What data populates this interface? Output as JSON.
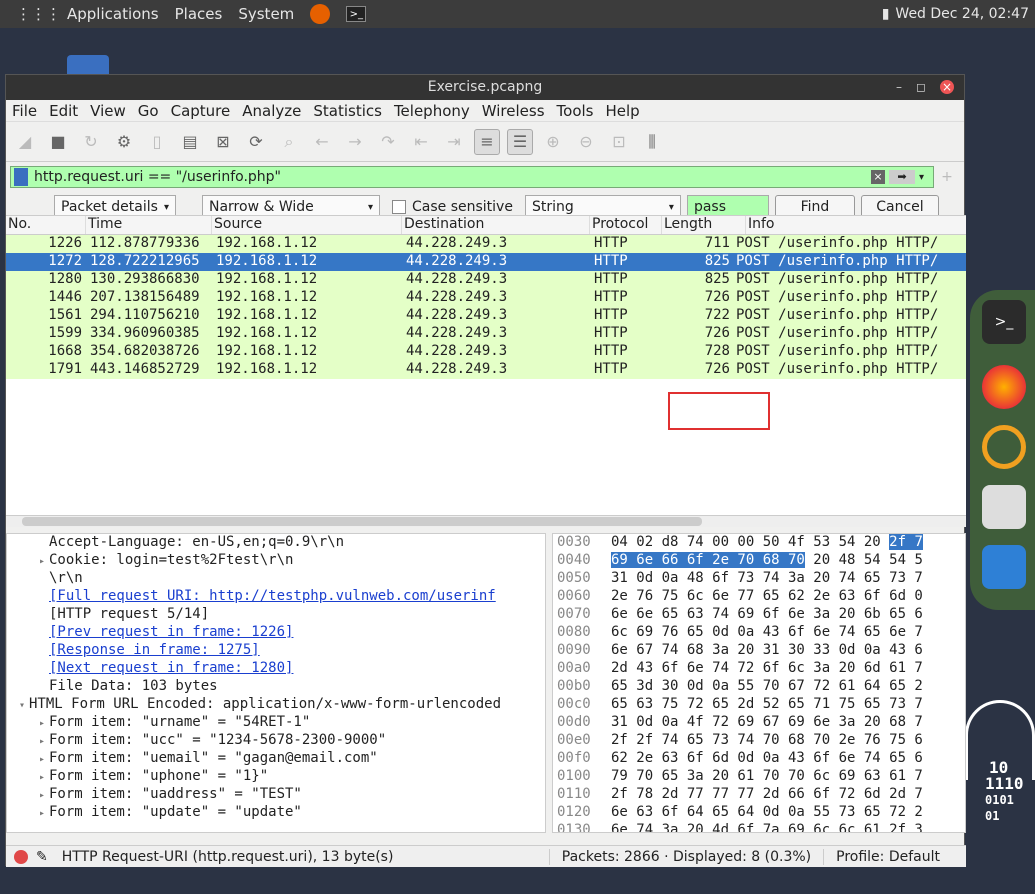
{
  "topbar": {
    "applications": "Applications",
    "places": "Places",
    "system": "System",
    "clock": "Wed Dec 24, 02:47"
  },
  "window": {
    "title": "Exercise.pcapng"
  },
  "menu": [
    "File",
    "Edit",
    "View",
    "Go",
    "Capture",
    "Analyze",
    "Statistics",
    "Telephony",
    "Wireless",
    "Tools",
    "Help"
  ],
  "filter": {
    "value": "http.request.uri == \"/userinfo.php\""
  },
  "find": {
    "search_in": "Packet details",
    "char_width": "Narrow & Wide",
    "case_sensitive": "Case sensitive",
    "type": "String",
    "query": "pass",
    "find_label": "Find",
    "cancel_label": "Cancel"
  },
  "columns": [
    "No.",
    "Time",
    "Source",
    "Destination",
    "Protocol",
    "Length",
    "Info"
  ],
  "packets": [
    {
      "no": "1226",
      "time": "112.878779336",
      "src": "192.168.1.12",
      "dst": "44.228.249.3",
      "proto": "HTTP",
      "len": "711",
      "info": "POST /userinfo.php HTTP/"
    },
    {
      "no": "1272",
      "time": "128.722212965",
      "src": "192.168.1.12",
      "dst": "44.228.249.3",
      "proto": "HTTP",
      "len": "825",
      "info": "POST /userinfo.php HTTP/"
    },
    {
      "no": "1280",
      "time": "130.293866830",
      "src": "192.168.1.12",
      "dst": "44.228.249.3",
      "proto": "HTTP",
      "len": "825",
      "info": "POST /userinfo.php HTTP/"
    },
    {
      "no": "1446",
      "time": "207.138156489",
      "src": "192.168.1.12",
      "dst": "44.228.249.3",
      "proto": "HTTP",
      "len": "726",
      "info": "POST /userinfo.php HTTP/"
    },
    {
      "no": "1561",
      "time": "294.110756210",
      "src": "192.168.1.12",
      "dst": "44.228.249.3",
      "proto": "HTTP",
      "len": "722",
      "info": "POST /userinfo.php HTTP/"
    },
    {
      "no": "1599",
      "time": "334.960960385",
      "src": "192.168.1.12",
      "dst": "44.228.249.3",
      "proto": "HTTP",
      "len": "726",
      "info": "POST /userinfo.php HTTP/"
    },
    {
      "no": "1668",
      "time": "354.682038726",
      "src": "192.168.1.12",
      "dst": "44.228.249.3",
      "proto": "HTTP",
      "len": "728",
      "info": "POST /userinfo.php HTTP/"
    },
    {
      "no": "1791",
      "time": "443.146852729",
      "src": "192.168.1.12",
      "dst": "44.228.249.3",
      "proto": "HTTP",
      "len": "726",
      "info": "POST /userinfo.php HTTP/"
    }
  ],
  "details": [
    "Accept-Language: en-US,en;q=0.9\\r\\n",
    "Cookie: login=test%2Ftest\\r\\n",
    "\\r\\n",
    "[Full request URI: http://testphp.vulnweb.com/userinf",
    "[HTTP request 5/14]",
    "[Prev request in frame: 1226]",
    "[Response in frame: 1275]",
    "[Next request in frame: 1280]",
    "File Data: 103 bytes",
    "HTML Form URL Encoded: application/x-www-form-urlencoded",
    "Form item: \"urname\" = \"54RET-1\"",
    "Form item: \"ucc\" = \"1234-5678-2300-9000\"",
    "Form item: \"uemail\" = \"gagan@email.com\"",
    "Form item: \"uphone\" = \"1}\"",
    "Form item: \"uaddress\" = \"TEST\"",
    "Form item: \"update\" = \"update\""
  ],
  "bytes": [
    {
      "off": "0030",
      "hex": "04 02 d8 74 00 00 50 4f  53 54 20 2f 7"
    },
    {
      "off": "0040",
      "hex": "69 6e 66 6f 2e 70 68 70  20 48 54 54 5"
    },
    {
      "off": "0050",
      "hex": "31 0d 0a 48 6f 73 74 3a  20 74 65 73 7"
    },
    {
      "off": "0060",
      "hex": "2e 76 75 6c 6e 77 65 62  2e 63 6f 6d 0"
    },
    {
      "off": "0070",
      "hex": "6e 6e 65 63 74 69 6f 6e  3a 20 6b 65 6"
    },
    {
      "off": "0080",
      "hex": "6c 69 76 65 0d 0a 43 6f  6e 74 65 6e 7"
    },
    {
      "off": "0090",
      "hex": "6e 67 74 68 3a 20 31 30  33 0d 0a 43 6"
    },
    {
      "off": "00a0",
      "hex": "2d 43 6f 6e 74 72 6f 6c  3a 20 6d 61 7"
    },
    {
      "off": "00b0",
      "hex": "65 3d 30 0d 0a 55 70 67  72 61 64 65 2"
    },
    {
      "off": "00c0",
      "hex": "65 63 75 72 65 2d 52 65  71 75 65 73 7"
    },
    {
      "off": "00d0",
      "hex": "31 0d 0a 4f 72 69 67 69  6e 3a 20 68 7"
    },
    {
      "off": "00e0",
      "hex": "2f 2f 74 65 73 74 70 68  70 2e 76 75 6"
    },
    {
      "off": "00f0",
      "hex": "62 2e 63 6f 6d 0d 0a 43  6f 6e 74 65 6"
    },
    {
      "off": "0100",
      "hex": "79 70 65 3a 20 61 70 70  6c 69 63 61 7"
    },
    {
      "off": "0110",
      "hex": "2f 78 2d 77 77 77 2d 66  6f 72 6d 2d 7"
    },
    {
      "off": "0120",
      "hex": "6e 63 6f 64 65 64 0d 0a  55 73 65 72 2"
    },
    {
      "off": "0130",
      "hex": "6e 74 3a 20 4d 6f 7a 69  6c 6c 61 2f 3"
    }
  ],
  "status": {
    "field": "HTTP Request-URI (http.request.uri), 13 byte(s)",
    "packets": "Packets: 2866 · Displayed: 8 (0.3%)",
    "profile": "Profile: Default"
  },
  "desktop": {
    "binary": [
      "10",
      "1110",
      "0101",
      "01"
    ]
  }
}
